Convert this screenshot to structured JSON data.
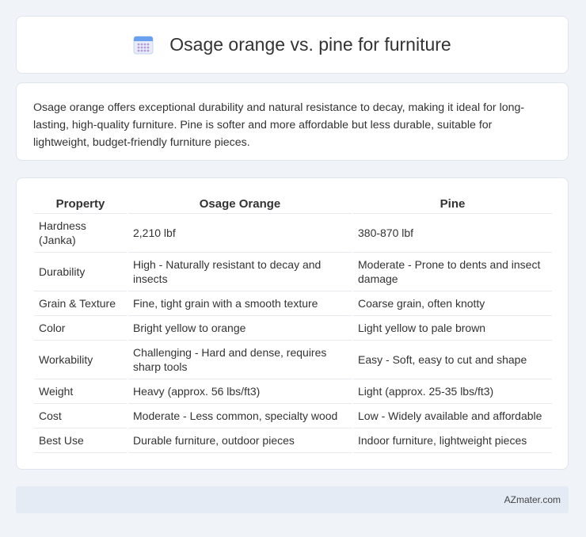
{
  "header": {
    "title": "Osage orange vs. pine for furniture",
    "icon": "calendar-icon",
    "icon_colors": {
      "top": "#6aa0f0",
      "body": "#e6ecf8",
      "dots": "#b79bd8"
    }
  },
  "summary": {
    "text": "Osage orange offers exceptional durability and natural resistance to decay, making it ideal for long-lasting, high-quality furniture. Pine is softer and more affordable but less durable, suitable for lightweight, budget-friendly furniture pieces."
  },
  "table": {
    "headers": [
      "Property",
      "Osage Orange",
      "Pine"
    ],
    "rows": [
      {
        "property": "Hardness (Janka)",
        "osage": "2,210 lbf",
        "pine": "380-870 lbf"
      },
      {
        "property": "Durability",
        "osage": "High - Naturally resistant to decay and insects",
        "pine": "Moderate - Prone to dents and insect damage"
      },
      {
        "property": "Grain & Texture",
        "osage": "Fine, tight grain with a smooth texture",
        "pine": "Coarse grain, often knotty"
      },
      {
        "property": "Color",
        "osage": "Bright yellow to orange",
        "pine": "Light yellow to pale brown"
      },
      {
        "property": "Workability",
        "osage": "Challenging - Hard and dense, requires sharp tools",
        "pine": "Easy - Soft, easy to cut and shape"
      },
      {
        "property": "Weight",
        "osage": "Heavy (approx. 56 lbs/ft3)",
        "pine": "Light (approx. 25-35 lbs/ft3)"
      },
      {
        "property": "Cost",
        "osage": "Moderate - Less common, specialty wood",
        "pine": "Low - Widely available and affordable"
      },
      {
        "property": "Best Use",
        "osage": "Durable furniture, outdoor pieces",
        "pine": "Indoor furniture, lightweight pieces"
      }
    ]
  },
  "footer": {
    "brand": "AZmater.com"
  }
}
